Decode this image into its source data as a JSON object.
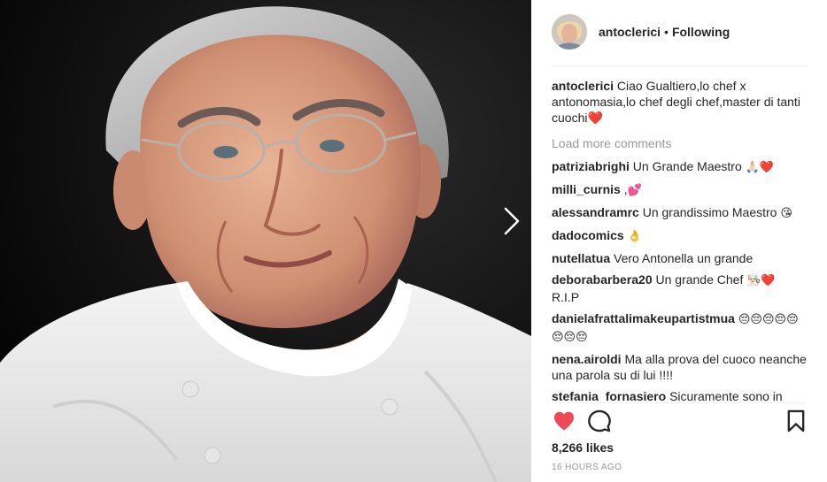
{
  "post": {
    "image_alt": "Portrait of an older chef in a white chef jacket",
    "author": "antoclerici",
    "separator": "•",
    "follow_state": "Following"
  },
  "caption": {
    "user": "antoclerici",
    "text": "Ciao Gualtiero,lo chef x antonomasia,lo chef degli chef,master di tanti cuochi",
    "emoji": "❤️"
  },
  "load_more": "Load more comments",
  "comments": [
    {
      "user": "patriziabrighi",
      "text": "Un Grande Maestro",
      "emoji": "🙏🏻❤️"
    },
    {
      "user": "milli_curnis",
      "text": ",",
      "emoji": "💕"
    },
    {
      "user": "alessandramrc",
      "text": "Un grandissimo Maestro",
      "emoji": "😘"
    },
    {
      "user": "dadocomics",
      "text": "",
      "emoji": "👌"
    },
    {
      "user": "nutellatua",
      "text": "Vero Antonella un grande",
      "emoji": ""
    },
    {
      "user": "deborabarbera20",
      "text": "Un grande Chef",
      "emoji": "👨🏻‍🍳❤️",
      "text2": "R.I.P"
    },
    {
      "user": "danielafrattalimakeupartistmua",
      "text": "",
      "emoji": "😔😔😔😔😔😔😔😔"
    },
    {
      "user": "nena.airoldi",
      "text": "Ma alla prova del cuoco neanche una parola su di lui !!!!",
      "emoji": ""
    },
    {
      "user": "stefania_fornasiero",
      "text": "Sicuramente sono in replica, sono in vacanza anche loro",
      "emoji": ""
    }
  ],
  "likes": "8,266 likes",
  "time": "16 HOURS AGO",
  "icons": {
    "like": "heart-icon",
    "comment": "comment-icon",
    "save": "bookmark-icon",
    "next": "chevron-right-icon"
  },
  "colors": {
    "like_active": "#ed4956",
    "secondary_text": "#999999",
    "primary_text": "#262626"
  }
}
